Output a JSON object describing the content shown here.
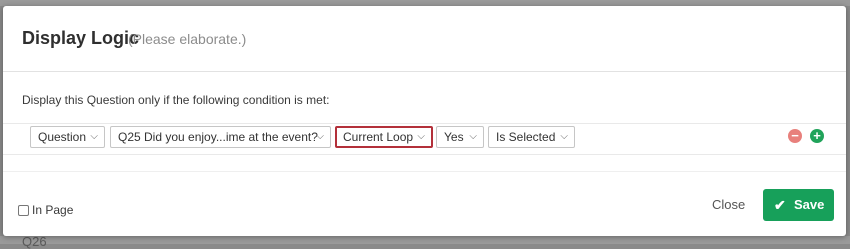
{
  "dialog": {
    "title": "Display Logic",
    "subtitle": "(Please elaborate.)"
  },
  "condition": {
    "instruction": "Display this Question only if the following condition is met:",
    "dropdowns": [
      {
        "value": "Question"
      },
      {
        "value": "Q25 Did you enjoy...ime at the event?"
      },
      {
        "value": "Current Loop"
      },
      {
        "value": "Yes"
      },
      {
        "value": "Is Selected"
      }
    ],
    "remove_symbol": "−",
    "add_symbol": "+"
  },
  "footer": {
    "in_page_label": "In Page",
    "close_label": "Close",
    "save_label": "Save"
  },
  "background": {
    "partial_label": "Q26"
  },
  "colors": {
    "save_green": "#17a05a",
    "add_green": "#20a35a",
    "remove_red": "#e8807c",
    "highlight_red": "#b3303a"
  }
}
